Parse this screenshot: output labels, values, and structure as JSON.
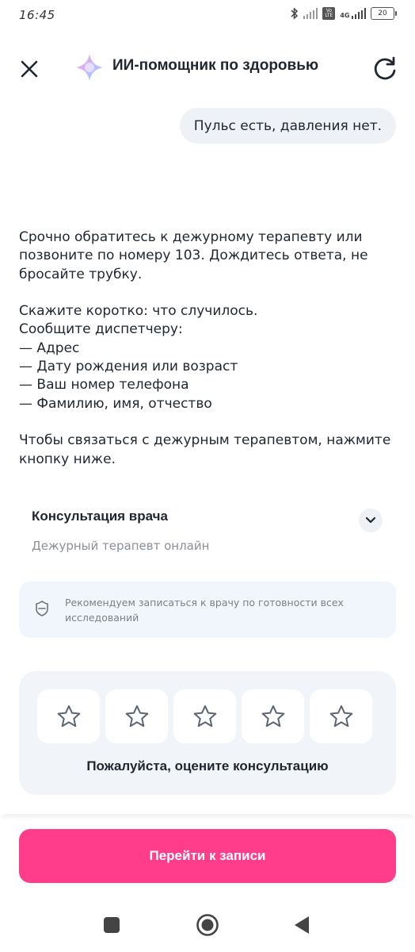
{
  "status_bar": {
    "time": "16:45",
    "battery": "20",
    "icons": [
      "bluetooth-icon",
      "signal-icon",
      "volte-icon",
      "4g-signal-icon",
      "battery-icon"
    ],
    "lte_badge": "Vo LTE",
    "network": "4G"
  },
  "header": {
    "title": "ИИ-помощник по здоровью",
    "close_icon": "close-icon",
    "refresh_icon": "refresh-icon"
  },
  "chat": {
    "user_message": "Пульс есть, давления нет.",
    "assistant_paragraphs": [
      "Срочно обратитесь к дежурному терапевту или позвоните по номеру 103. Дождитесь ответа, не бросайте трубку.",
      "",
      "Скажите коротко: что случилось.",
      "Сообщите диспетчеру:",
      "— Адрес",
      "— Дату рождения или возраст",
      "— Ваш номер телефона",
      "— Фамилию, имя, отчество",
      "",
      "Чтобы связаться с дежурным терапевтом, нажмите кнопку ниже."
    ]
  },
  "consultation": {
    "title": "Консультация врача",
    "subtitle": "Дежурный терапевт онлайн"
  },
  "info": {
    "text": "Рекомендуем записаться к врачу по готовности всех исследований"
  },
  "rating": {
    "stars_total": 5,
    "stars_selected": 0,
    "label": "Пожалуйста, оцените консультацию"
  },
  "primary_button": {
    "label": "Перейти к записи"
  },
  "colors": {
    "accent": "#ff3d8b",
    "bubble": "#eef1f5",
    "info_bg": "#f1f6fc",
    "rating_bg": "#f1f4f8",
    "text": "#1f2630",
    "muted": "#8a8f98"
  }
}
